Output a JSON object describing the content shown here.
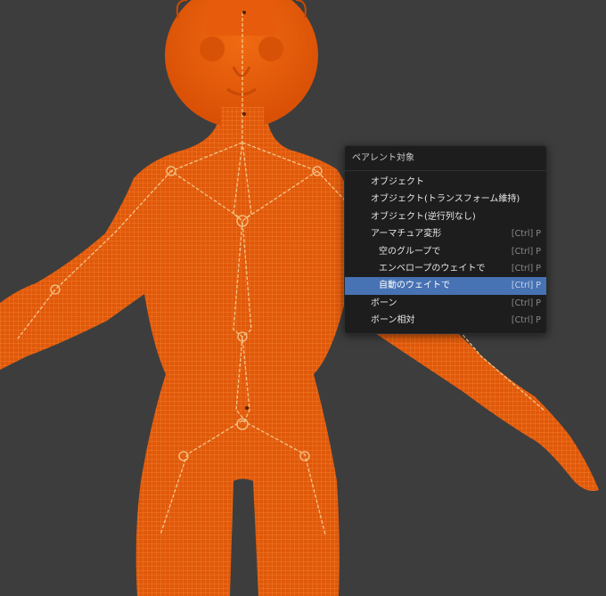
{
  "viewport": {
    "background": "#3d3d3d",
    "mesh_color": "#e35b0a",
    "wire_color": "#ff8a2a",
    "bone_color": "#f2c27a"
  },
  "menu": {
    "title": "ペアレント対象",
    "items": [
      {
        "label": "オブジェクト",
        "shortcut": "",
        "indent": false,
        "active": false
      },
      {
        "label": "オブジェクト(トランスフォーム維持)",
        "shortcut": "",
        "indent": false,
        "active": false
      },
      {
        "label": "オブジェクト(逆行列なし)",
        "shortcut": "",
        "indent": false,
        "active": false
      },
      {
        "label": "アーマチュア変形",
        "shortcut": "[Ctrl] P",
        "indent": false,
        "active": false
      },
      {
        "label": "空のグループで",
        "shortcut": "[Ctrl] P",
        "indent": true,
        "active": false
      },
      {
        "label": "エンベロープのウェイトで",
        "shortcut": "[Ctrl] P",
        "indent": true,
        "active": false
      },
      {
        "label": "自動のウェイトで",
        "shortcut": "[Ctrl] P",
        "indent": true,
        "active": true
      },
      {
        "label": "ボーン",
        "shortcut": "[Ctrl] P",
        "indent": false,
        "active": false
      },
      {
        "label": "ボーン相対",
        "shortcut": "[Ctrl] P",
        "indent": false,
        "active": false
      }
    ]
  }
}
